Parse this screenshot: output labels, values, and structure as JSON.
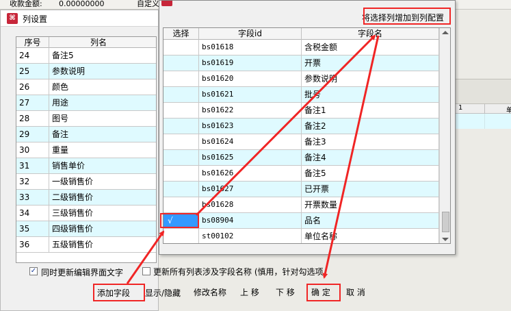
{
  "background": {
    "top_label_1": "收款金额:",
    "top_value_1": "0.00000000",
    "top_label_2": "自定义",
    "right_header_1": "1",
    "right_header_2": "单"
  },
  "col_dialog": {
    "title": "列设置",
    "icon": "app-logo-icon",
    "headers": {
      "seq": "序号",
      "name": "列名"
    },
    "rows": [
      {
        "seq": "24",
        "name": "备注5"
      },
      {
        "seq": "25",
        "name": "参数说明"
      },
      {
        "seq": "26",
        "name": "颜色"
      },
      {
        "seq": "27",
        "name": "用途"
      },
      {
        "seq": "28",
        "name": "图号"
      },
      {
        "seq": "29",
        "name": "备注"
      },
      {
        "seq": "30",
        "name": "重量"
      },
      {
        "seq": "31",
        "name": "销售单价"
      },
      {
        "seq": "32",
        "name": "一级销售价"
      },
      {
        "seq": "33",
        "name": "二级销售价"
      },
      {
        "seq": "34",
        "name": "三级销售价"
      },
      {
        "seq": "35",
        "name": "四级销售价"
      },
      {
        "seq": "36",
        "name": "五级销售价"
      }
    ],
    "sync_checkbox": {
      "label": "同时更新编辑界面文字",
      "checked": true
    },
    "update_all_checkbox": {
      "label": "更新所有列表涉及字段名称 (慎用，针对勾选项",
      "checked": false
    },
    "buttons": {
      "add_field": "添加字段",
      "show_hide": "显示/隐藏",
      "rename": "修改名称",
      "move_up": "上 移",
      "move_down": "下 移",
      "ok": "确 定",
      "cancel": "取 消"
    }
  },
  "field_dialog": {
    "icon": "app-logo-icon",
    "add_to_config_button": "将选择列增加到列配置",
    "headers": {
      "select": "选择",
      "field_id": "字段id",
      "field_name": "字段名"
    },
    "rows": [
      {
        "selected": "",
        "field_id": "bs01618",
        "field_name": "含税金额"
      },
      {
        "selected": "",
        "field_id": "bs01619",
        "field_name": "开票"
      },
      {
        "selected": "",
        "field_id": "bs01620",
        "field_name": "参数说明"
      },
      {
        "selected": "",
        "field_id": "bs01621",
        "field_name": "批号"
      },
      {
        "selected": "",
        "field_id": "bs01622",
        "field_name": "备注1"
      },
      {
        "selected": "",
        "field_id": "bs01623",
        "field_name": "备注2"
      },
      {
        "selected": "",
        "field_id": "bs01624",
        "field_name": "备注3"
      },
      {
        "selected": "",
        "field_id": "bs01625",
        "field_name": "备注4"
      },
      {
        "selected": "",
        "field_id": "bs01626",
        "field_name": "备注5"
      },
      {
        "selected": "",
        "field_id": "bs01627",
        "field_name": "已开票"
      },
      {
        "selected": "",
        "field_id": "bs01628",
        "field_name": "开票数量"
      },
      {
        "selected": "√",
        "field_id": "bs08904",
        "field_name": "品名"
      },
      {
        "selected": "",
        "field_id": "st00102",
        "field_name": "单位名称"
      }
    ]
  },
  "colors": {
    "row_alt": "#dffaff",
    "selection": "#3399ff",
    "highlight": "#f02525"
  }
}
